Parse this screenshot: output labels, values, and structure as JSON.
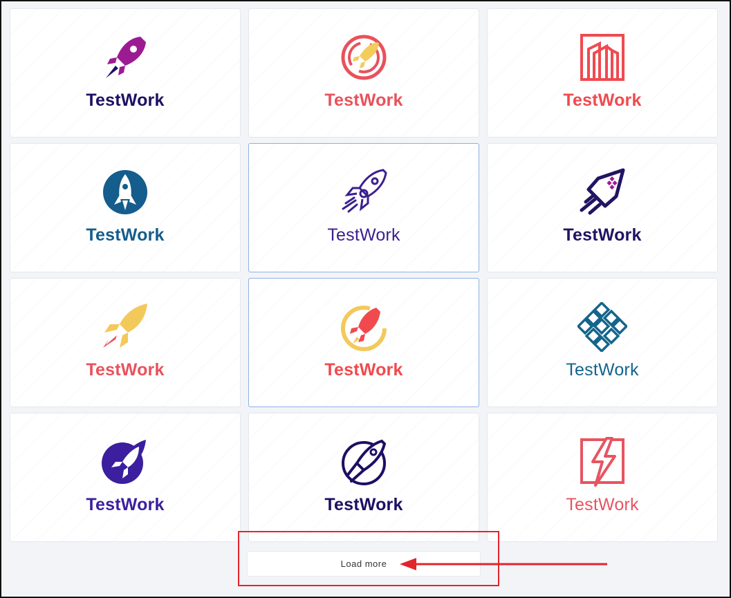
{
  "cards": [
    {
      "brand": "TestWork",
      "color": "#1d0f63",
      "icon": "rocket-magenta-icon"
    },
    {
      "brand": "TestWork",
      "color": "#e8525c",
      "icon": "rocket-circle-coral-icon"
    },
    {
      "brand": "TestWork",
      "color": "#f04a4f",
      "icon": "building-outline-icon"
    },
    {
      "brand": "TestWork",
      "color": "#145d8c",
      "icon": "rocket-circle-blue-icon"
    },
    {
      "brand": "TestWork",
      "color": "#3b1f8f",
      "icon": "rocket-outline-purple-icon"
    },
    {
      "brand": "TestWork",
      "color": "#201463",
      "icon": "rocket-angular-navy-icon"
    },
    {
      "brand": "TestWork",
      "color": "#e8525c",
      "icon": "rocket-yellow-icon"
    },
    {
      "brand": "TestWork",
      "color": "#f04a4f",
      "icon": "rocket-sun-icon"
    },
    {
      "brand": "TestWork",
      "color": "#14658c",
      "icon": "diamond-knot-icon"
    },
    {
      "brand": "TestWork",
      "color": "#3b1f9f",
      "icon": "rocket-circle-purple-icon"
    },
    {
      "brand": "TestWork",
      "color": "#1d0f63",
      "icon": "rocket-planet-icon"
    },
    {
      "brand": "TestWork",
      "color": "#e65561",
      "icon": "lightning-square-icon"
    }
  ],
  "load_more": {
    "label": "Load more"
  },
  "annotation": {
    "box_color": "#e2242c",
    "arrow_color": "#e2242c"
  }
}
